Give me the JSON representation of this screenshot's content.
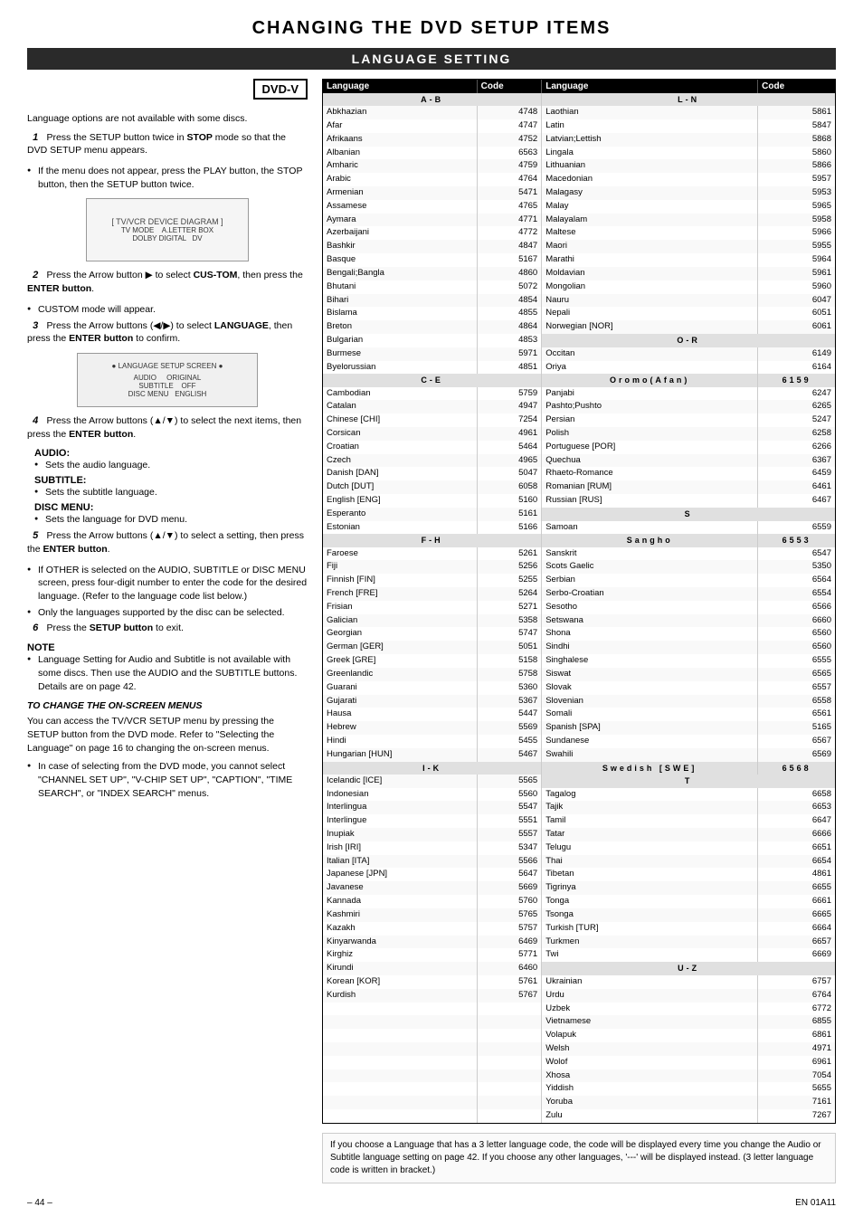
{
  "page": {
    "main_title": "CHANGING THE DVD SETUP ITEMS",
    "section_title": "LANGUAGE SETTING",
    "page_number": "– 44 –",
    "lang_code": "EN 01A11"
  },
  "left": {
    "dvd_label": "DVD-V",
    "intro_text": "Language options are not available with some discs.",
    "steps": [
      {
        "number": "1",
        "text": "Press the SETUP button twice in STOP mode so that the DVD SETUP menu appears."
      },
      {
        "bullet": "If the menu does not appear, press the PLAY button, the STOP button, then the SETUP button twice."
      },
      {
        "number": "2",
        "text": "Press the Arrow button ▶ to select CUS-TOM, then press the ENTER button.",
        "bullet": "CUSTOM mode will appear."
      },
      {
        "number": "3",
        "text": "Press the Arrow buttons (◀/▶) to select LANGUAGE, then press the ENTER button to confirm."
      },
      {
        "number": "4",
        "text": "Press the Arrow buttons (▲/▼) to select the next items, then press the ENTER button.",
        "sublabels": [
          "AUDIO:",
          "SUBTITLE:",
          "DISC MENU:"
        ],
        "subitems": [
          "Sets the audio language.",
          "Sets the subtitle language.",
          "Sets the language for DVD menu."
        ]
      },
      {
        "number": "5",
        "text": "Press the Arrow buttons (▲/▼) to select a setting, then press the ENTER button.",
        "bullets": [
          "If OTHER is selected on the AUDIO, SUBTITLE or DISC MENU screen, press four-digit number to enter the code for the desired language. (Refer to the language code list below.)",
          "Only the languages supported by the disc can be selected."
        ]
      },
      {
        "number": "6",
        "text": "Press the SETUP button to exit."
      }
    ],
    "note_title": "NOTE",
    "note_bullets": [
      "Language Setting for Audio and Subtitle is not available with some discs. Then use the AUDIO and the SUBTITLE buttons. Details are on page 42."
    ],
    "on_screen_title": "TO CHANGE THE ON-SCREEN MENUS",
    "on_screen_text": "You can access the TV/VCR SETUP menu by pressing the SETUP button from the DVD mode. Refer to \"Selecting the Language\" on page 16 to changing the on-screen menus.",
    "on_screen_bullet": "In case of selecting from the DVD mode, you cannot select \"CHANNEL SET UP\", \"V-CHIP SET UP\", \"CAPTION\", \"TIME SEARCH\", or \"INDEX SEARCH\" menus."
  },
  "table": {
    "headers": [
      "Language",
      "Code",
      "Language",
      "Code"
    ],
    "sections": {
      "AB": {
        "label": "A-B",
        "rows": [
          [
            "Abkhazian",
            "4748"
          ],
          [
            "Afar",
            "4747"
          ],
          [
            "Afrikaans",
            "4752"
          ],
          [
            "Albanian",
            "6563"
          ],
          [
            "Amharic",
            "4759"
          ],
          [
            "Arabic",
            "4764"
          ],
          [
            "Armenian",
            "5471"
          ],
          [
            "Assamese",
            "4765"
          ],
          [
            "Aymara",
            "4771"
          ],
          [
            "Azerbaijani",
            "4772"
          ],
          [
            "Bashkir",
            "4847"
          ],
          [
            "Basque",
            "5167"
          ],
          [
            "Bengali;Bangla",
            "4860"
          ],
          [
            "Bhutani",
            "5072"
          ],
          [
            "Bihari",
            "4854"
          ],
          [
            "Bislama",
            "4855"
          ],
          [
            "Breton",
            "4864"
          ],
          [
            "Bulgarian",
            "4853"
          ],
          [
            "Burmese",
            "5971"
          ],
          [
            "Byelorussian",
            "4851"
          ]
        ]
      },
      "CE": {
        "label": "C-E",
        "rows": [
          [
            "Cambodian",
            "5759"
          ],
          [
            "Catalan",
            "4947"
          ],
          [
            "Chinese [CHI]",
            "7254"
          ],
          [
            "Corsican",
            "4961"
          ],
          [
            "Croatian",
            "5464"
          ],
          [
            "Czech",
            "4965"
          ],
          [
            "Danish [DAN]",
            "5047"
          ],
          [
            "Dutch [DUT]",
            "6058"
          ],
          [
            "English [ENG]",
            "5160"
          ],
          [
            "Esperanto",
            "5161"
          ],
          [
            "Estonian",
            "5166"
          ]
        ]
      },
      "FH": {
        "label": "F-H",
        "rows": [
          [
            "Faroese",
            "5261"
          ],
          [
            "Fiji",
            "5256"
          ],
          [
            "Finnish [FIN]",
            "5255"
          ],
          [
            "French [FRE]",
            "5264"
          ],
          [
            "Frisian",
            "5271"
          ],
          [
            "Galician",
            "5358"
          ],
          [
            "Georgian",
            "5747"
          ],
          [
            "German [GER]",
            "5051"
          ],
          [
            "Greek [GRE]",
            "5158"
          ],
          [
            "Greenlandic",
            "5758"
          ],
          [
            "Guarani",
            "5360"
          ],
          [
            "Gujarati",
            "5367"
          ],
          [
            "Hausa",
            "5447"
          ],
          [
            "Hebrew",
            "5569"
          ],
          [
            "Hindi",
            "5455"
          ],
          [
            "Hungarian [HUN]",
            "5467"
          ]
        ]
      },
      "IK": {
        "label": "I-K",
        "rows": [
          [
            "Icelandic [ICE]",
            "5565"
          ],
          [
            "Indonesian",
            "5560"
          ],
          [
            "Interlingua",
            "5547"
          ],
          [
            "Interlingue",
            "5551"
          ],
          [
            "Inupiak",
            "5557"
          ],
          [
            "Irish [IRI]",
            "5347"
          ],
          [
            "Italian [ITA]",
            "5566"
          ],
          [
            "Japanese [JPN]",
            "5647"
          ],
          [
            "Javanese",
            "5669"
          ],
          [
            "Kannada",
            "5760"
          ],
          [
            "Kashmiri",
            "5765"
          ],
          [
            "Kazakh",
            "5757"
          ],
          [
            "Kinyarwanda",
            "6469"
          ],
          [
            "Kirghiz",
            "5771"
          ],
          [
            "Kirundi",
            "6460"
          ],
          [
            "Korean [KOR]",
            "5761"
          ],
          [
            "Kurdish",
            "5767"
          ]
        ]
      },
      "LN": {
        "label": "L-N",
        "rows": [
          [
            "Laothian",
            "5861"
          ],
          [
            "Latin",
            "5847"
          ],
          [
            "Latvian;Lettish",
            "5868"
          ],
          [
            "Lingala",
            "5860"
          ],
          [
            "Lithuanian",
            "5866"
          ],
          [
            "Macedonian",
            "5957"
          ],
          [
            "Malagasy",
            "5953"
          ],
          [
            "Malay",
            "5965"
          ],
          [
            "Malayalam",
            "5958"
          ],
          [
            "Maltese",
            "5966"
          ],
          [
            "Maori",
            "5955"
          ],
          [
            "Marathi",
            "5964"
          ],
          [
            "Moldavian",
            "5961"
          ],
          [
            "Mongolian",
            "5960"
          ],
          [
            "Nauru",
            "6047"
          ],
          [
            "Nepali",
            "6051"
          ],
          [
            "Norwegian [NOR]",
            "6061"
          ]
        ]
      },
      "OR": {
        "label": "O-R",
        "rows": [
          [
            "Occitan",
            "6149"
          ],
          [
            "Oriya",
            "6164"
          ],
          [
            "Oromo(Afan)",
            "6159"
          ],
          [
            "Panjabi",
            "6247"
          ],
          [
            "Pashto;Pushto",
            "6265"
          ],
          [
            "Persian",
            "5247"
          ],
          [
            "Polish",
            "6258"
          ],
          [
            "Portuguese [POR]",
            "6266"
          ],
          [
            "Quechua",
            "6367"
          ],
          [
            "Rhaeto-Romance",
            "6459"
          ],
          [
            "Romanian [RUM]",
            "6461"
          ],
          [
            "Russian [RUS]",
            "6467"
          ]
        ]
      },
      "S": {
        "label": "S",
        "rows": [
          [
            "Samoan",
            "6559"
          ],
          [
            "Sangho",
            "6553"
          ],
          [
            "Sanskrit",
            "6547"
          ],
          [
            "Scots Gaelic",
            "5350"
          ],
          [
            "Serbian",
            "6564"
          ],
          [
            "Serbo-Croatian",
            "6554"
          ],
          [
            "Sesotho",
            "6566"
          ],
          [
            "Setswana",
            "6660"
          ],
          [
            "Shona",
            "6560"
          ],
          [
            "Sindhi",
            "6560"
          ],
          [
            "Singhalese",
            "6555"
          ],
          [
            "Siswat",
            "6565"
          ],
          [
            "Slovak",
            "6557"
          ],
          [
            "Slovenian",
            "6558"
          ],
          [
            "Somali",
            "6561"
          ],
          [
            "Spanish [SPA]",
            "5165"
          ],
          [
            "Sundanese",
            "6567"
          ],
          [
            "Swahili",
            "6569"
          ],
          [
            "Swedish [SWE]",
            "6568"
          ]
        ]
      },
      "T": {
        "label": "T",
        "rows": [
          [
            "Tagalog",
            "6658"
          ],
          [
            "Tajik",
            "6653"
          ],
          [
            "Tamil",
            "6647"
          ],
          [
            "Tatar",
            "6666"
          ],
          [
            "Telugu",
            "6651"
          ],
          [
            "Thai",
            "6654"
          ],
          [
            "Tibetan",
            "4861"
          ],
          [
            "Tigrinya",
            "6655"
          ],
          [
            "Tonga",
            "6661"
          ],
          [
            "Tsonga",
            "6665"
          ],
          [
            "Turkish [TUR]",
            "6664"
          ],
          [
            "Turkmen",
            "6657"
          ],
          [
            "Twi",
            "6669"
          ]
        ]
      },
      "UZ": {
        "label": "U-Z",
        "rows": [
          [
            "Ukrainian",
            "6757"
          ],
          [
            "Urdu",
            "6764"
          ],
          [
            "Uzbek",
            "6772"
          ],
          [
            "Vietnamese",
            "6855"
          ],
          [
            "Volapuk",
            "6861"
          ],
          [
            "Welsh",
            "4971"
          ],
          [
            "Wolof",
            "6961"
          ],
          [
            "Xhosa",
            "7054"
          ],
          [
            "Yiddish",
            "5655"
          ],
          [
            "Yoruba",
            "7161"
          ],
          [
            "Zulu",
            "7267"
          ]
        ]
      }
    }
  },
  "footer_note": "If you choose a Language that has a 3 letter language code, the code will be displayed every time you change the Audio or Subtitle language setting on page 42. If you choose any other languages, '---' will be displayed instead. (3 letter language code is written in bracket.)"
}
